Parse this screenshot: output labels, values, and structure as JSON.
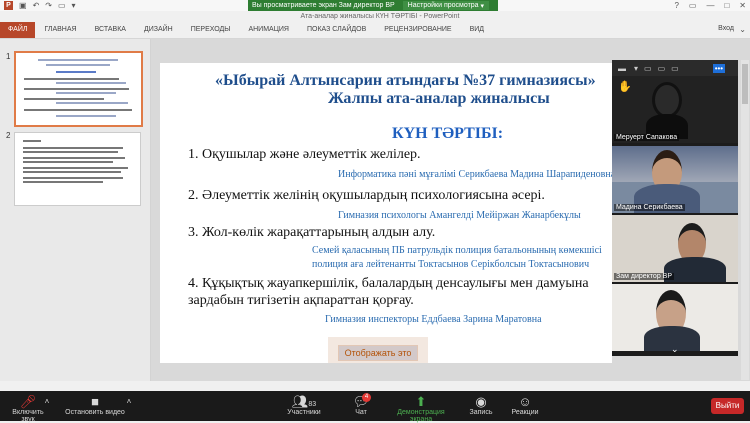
{
  "window": {
    "title": "Ата-аналар жиналысы КҮН ТӘРТІБІ - PowerPoint",
    "login": "Вход"
  },
  "share": {
    "banner": "Вы просматриваете экран Зам директор ВР",
    "options": "Настройки просмотра"
  },
  "ribbon": {
    "tabs": [
      "ФАЙЛ",
      "ГЛАВНАЯ",
      "ВСТАВКА",
      "ДИЗАЙН",
      "ПЕРЕХОДЫ",
      "АНИМАЦИЯ",
      "ПОКАЗ СЛАЙДОВ",
      "РЕЦЕНЗИРОВАНИЕ",
      "ВИД"
    ]
  },
  "thumbnails": {
    "numbers": [
      "1",
      "2"
    ]
  },
  "slide": {
    "title_line1": "«Ыбырай Алтынсарин атындағы №37 гимназиясы»",
    "title_line2": "Жалпы ата-аналар жиналысы",
    "agenda": "КҮН ТӘРТІБІ:",
    "items": [
      {
        "text": "1.   Оқушылар және әлеуметтік желілер.",
        "speaker": "Информатика пәні мұғалімі   Серикбаева Мадина Шарапиденовна"
      },
      {
        "text": "2.   Әлеуметтік желінің оқушылардың психологиясына әсері.",
        "speaker": "Гимназия психологы Амангелді Мейіржан Жанарбекұлы"
      },
      {
        "text": "3. Жол-көлік жарақаттарының алдын алу.",
        "speaker": "Семей қаласының ПБ патрульдік полиция батальонының көмекшісі",
        "speaker2": "полиция аға лейтенанты  Токтасынов Серікболсын Токтасынович"
      },
      {
        "text": "4. Құқықтық жауапкершілік, балалардың денсаулығы мен дамуына",
        "text2": "зардабын тигізетін ақпараттан қорғау.",
        "speaker": "Гимназия инспекторы Еддбаева Зарина Маратовна"
      }
    ],
    "hidden_button": "Отображать это"
  },
  "video": {
    "participants": [
      {
        "name": "Меруерт Сапакова"
      },
      {
        "name": "Мадина Серикбаева"
      },
      {
        "name": "Зам директор ВР"
      },
      {
        "name": ""
      }
    ]
  },
  "toolbar": {
    "mute": "Включить звук",
    "video": "Остановить видео",
    "participants": "Участники",
    "participants_count": "83",
    "chat": "Чат",
    "chat_badge": "4",
    "share": "Демонстрация экрана",
    "record": "Запись",
    "reactions": "Реакции",
    "leave": "Выйти"
  },
  "colors": {
    "accent": "#b7472a",
    "share_green": "#2e7d32",
    "slide_title": "#1f4e8c",
    "leave_red": "#c62828"
  }
}
